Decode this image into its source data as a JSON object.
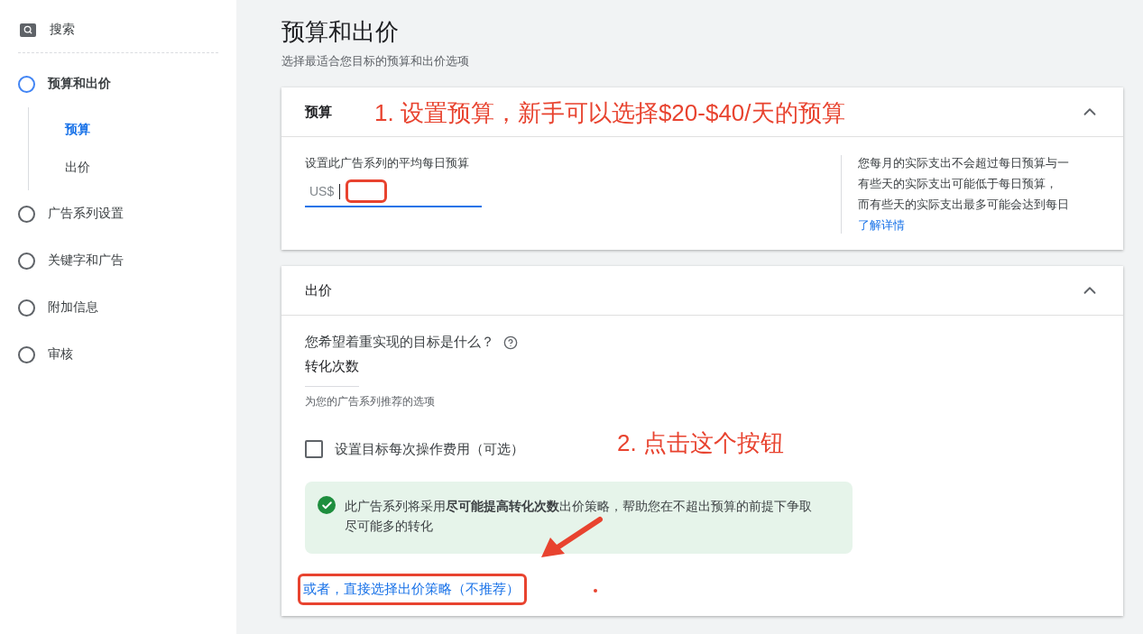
{
  "sidebar": {
    "search": "搜索",
    "steps": [
      {
        "label": "预算和出价",
        "selected": true,
        "children": [
          {
            "label": "预算",
            "selected": true
          },
          {
            "label": "出价",
            "selected": false
          }
        ]
      },
      {
        "label": "广告系列设置",
        "selected": false
      },
      {
        "label": "关键字和广告",
        "selected": false
      },
      {
        "label": "附加信息",
        "selected": false
      },
      {
        "label": "审核",
        "selected": false
      }
    ]
  },
  "page": {
    "title": "预算和出价",
    "subtitle": "选择最适合您目标的预算和出价选项"
  },
  "budget_card": {
    "title": "预算",
    "expanded": true,
    "field_label": "设置此广告系列的平均每日预算",
    "currency": "US$",
    "help_lines": [
      "您每月的实际支出不会超过每日预算与一",
      "有些天的实际支出可能低于每日预算，",
      "而有些天的实际支出最多可能会达到每日"
    ],
    "learn_more": "了解详情"
  },
  "bidding_card": {
    "title": "出价",
    "expanded": true,
    "question": "您希望着重实现的目标是什么？",
    "dropdown_value": "转化次数",
    "hint": "为您的广告系列推荐的选项",
    "checkbox": {
      "label": "设置目标每次操作费用（可选）",
      "checked": false
    },
    "notice": "此广告系列将采用**尽可能提高转化次数**出价策略，帮助您在不超出预算的前提下争取尽可能多的转化",
    "link": "或者，直接选择出价策略（不推荐）"
  },
  "annotations": [
    {
      "kind": "label",
      "text": "1. 设置预算，新手可以选择$20-$40/天的预算"
    },
    {
      "kind": "label",
      "text": "2. 点击这个按钮"
    },
    {
      "kind": "box"
    },
    {
      "kind": "box"
    },
    {
      "kind": "arrow"
    },
    {
      "kind": "dot"
    }
  ]
}
